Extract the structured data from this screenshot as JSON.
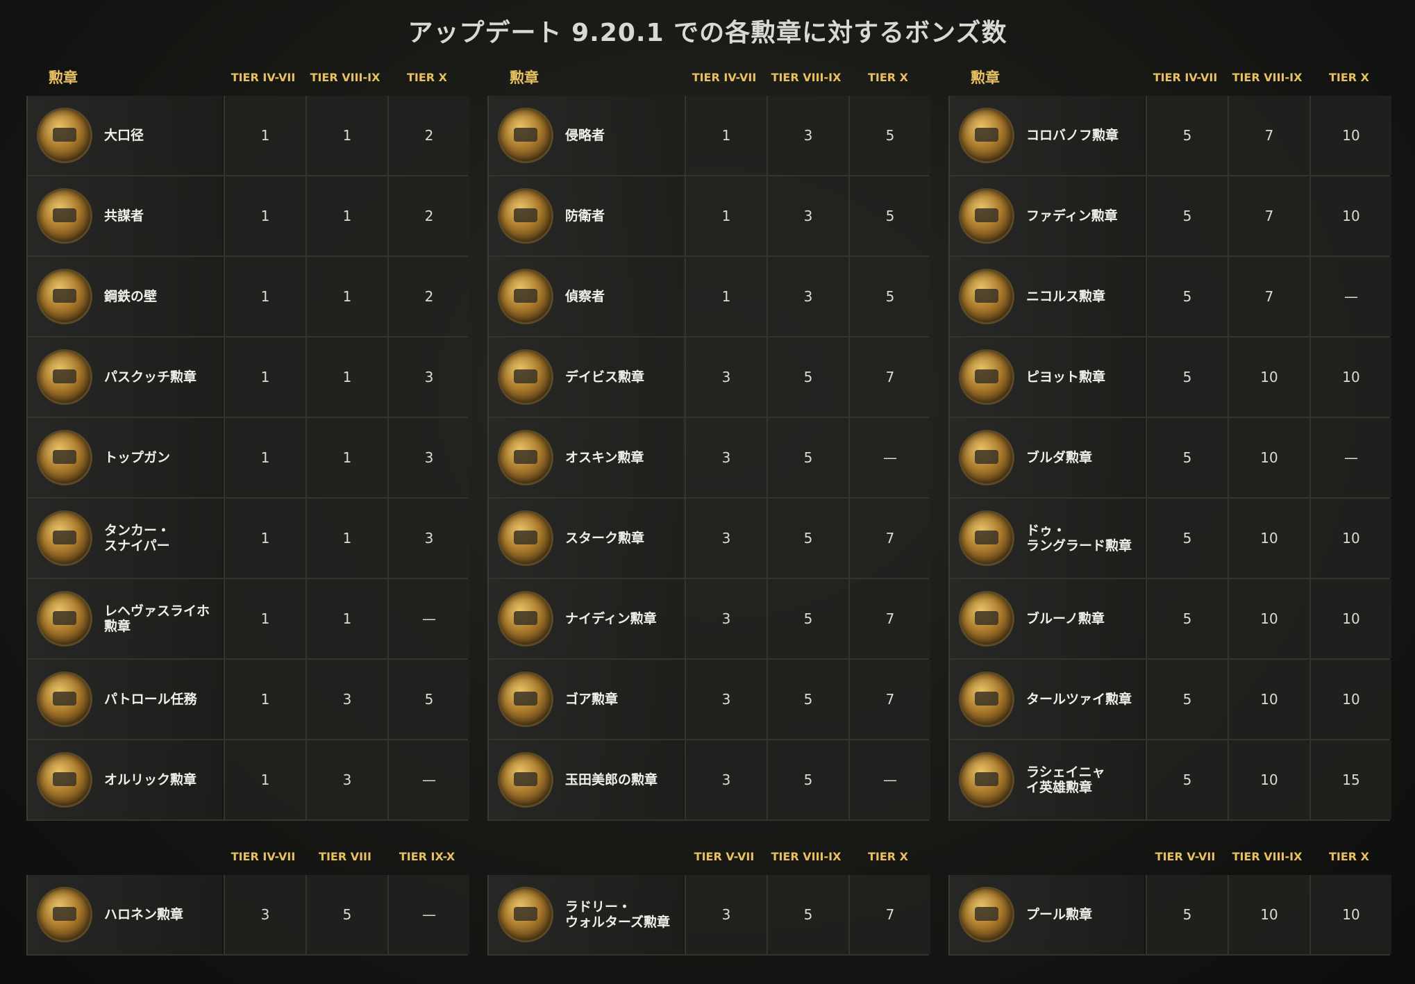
{
  "title": "アップデート 9.20.1 での各勲章に対するボンズ数",
  "panels": [
    {
      "header": {
        "medal": "勲章",
        "t1": "TIER IV-VII",
        "t2": "TIER VIII-IX",
        "t3": "TIER X"
      },
      "rows": [
        {
          "name": "大口径",
          "v1": "1",
          "v2": "1",
          "v3": "2"
        },
        {
          "name": "共謀者",
          "v1": "1",
          "v2": "1",
          "v3": "2"
        },
        {
          "name": "鋼鉄の壁",
          "v1": "1",
          "v2": "1",
          "v3": "2"
        },
        {
          "name": "パスクッチ勲章",
          "v1": "1",
          "v2": "1",
          "v3": "3"
        },
        {
          "name": "トップガン",
          "v1": "1",
          "v2": "1",
          "v3": "3"
        },
        {
          "name": "タンカー・\nスナイパー",
          "v1": "1",
          "v2": "1",
          "v3": "3"
        },
        {
          "name": "レヘヴァスライホ\n勲章",
          "v1": "1",
          "v2": "1",
          "v3": "—"
        },
        {
          "name": "パトロール任務",
          "v1": "1",
          "v2": "3",
          "v3": "5"
        },
        {
          "name": "オルリック勲章",
          "v1": "1",
          "v2": "3",
          "v3": "—"
        }
      ]
    },
    {
      "header": {
        "medal": "勲章",
        "t1": "TIER IV-VII",
        "t2": "TIER VIII-IX",
        "t3": "TIER X"
      },
      "rows": [
        {
          "name": "侵略者",
          "v1": "1",
          "v2": "3",
          "v3": "5"
        },
        {
          "name": "防衛者",
          "v1": "1",
          "v2": "3",
          "v3": "5"
        },
        {
          "name": "偵察者",
          "v1": "1",
          "v2": "3",
          "v3": "5"
        },
        {
          "name": "デイビス勲章",
          "v1": "3",
          "v2": "5",
          "v3": "7"
        },
        {
          "name": "オスキン勲章",
          "v1": "3",
          "v2": "5",
          "v3": "—"
        },
        {
          "name": "スターク勲章",
          "v1": "3",
          "v2": "5",
          "v3": "7"
        },
        {
          "name": "ナイディン勲章",
          "v1": "3",
          "v2": "5",
          "v3": "7"
        },
        {
          "name": "ゴア勲章",
          "v1": "3",
          "v2": "5",
          "v3": "7"
        },
        {
          "name": "玉田美郎の勲章",
          "v1": "3",
          "v2": "5",
          "v3": "—"
        }
      ]
    },
    {
      "header": {
        "medal": "勲章",
        "t1": "TIER IV-VII",
        "t2": "TIER VIII-IX",
        "t3": "TIER X"
      },
      "rows": [
        {
          "name": "コロバノフ勲章",
          "v1": "5",
          "v2": "7",
          "v3": "10"
        },
        {
          "name": "ファディン勲章",
          "v1": "5",
          "v2": "7",
          "v3": "10"
        },
        {
          "name": "ニコルス勲章",
          "v1": "5",
          "v2": "7",
          "v3": "—"
        },
        {
          "name": "ピヨット勲章",
          "v1": "5",
          "v2": "10",
          "v3": "10"
        },
        {
          "name": "ブルダ勲章",
          "v1": "5",
          "v2": "10",
          "v3": "—"
        },
        {
          "name": "ドゥ・\nラングラード勲章",
          "v1": "5",
          "v2": "10",
          "v3": "10"
        },
        {
          "name": "ブルーノ勲章",
          "v1": "5",
          "v2": "10",
          "v3": "10"
        },
        {
          "name": "タールツァイ勲章",
          "v1": "5",
          "v2": "10",
          "v3": "10"
        },
        {
          "name": "ラシェイニャ\nイ英雄勲章",
          "v1": "5",
          "v2": "10",
          "v3": "15"
        }
      ]
    }
  ],
  "bottom": [
    {
      "header": {
        "t1": "TIER IV-VII",
        "t2": "TIER VIII",
        "t3": "TIER IX-X"
      },
      "row": {
        "name": "ハロネン勲章",
        "v1": "3",
        "v2": "5",
        "v3": "—"
      }
    },
    {
      "header": {
        "t1": "TIER V-VII",
        "t2": "TIER VIII-IX",
        "t3": "TIER X"
      },
      "row": {
        "name": "ラドリー・\nウォルターズ勲章",
        "v1": "3",
        "v2": "5",
        "v3": "7"
      }
    },
    {
      "header": {
        "t1": "TIER V-VII",
        "t2": "TIER VIII-IX",
        "t3": "TIER X"
      },
      "row": {
        "name": "プール勲章",
        "v1": "5",
        "v2": "10",
        "v3": "10"
      }
    }
  ]
}
